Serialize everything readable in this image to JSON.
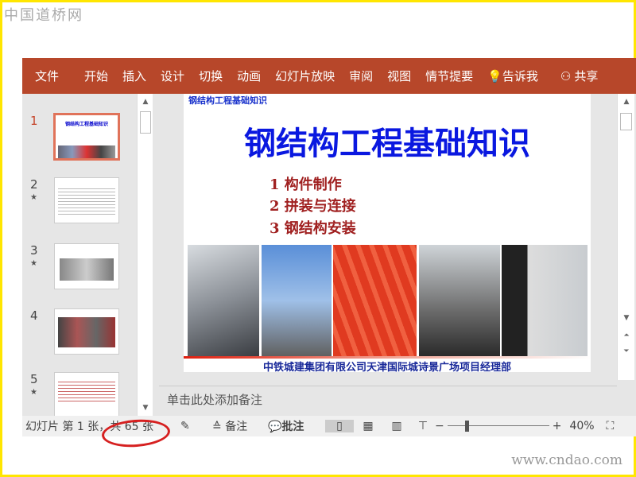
{
  "watermark_top": "中国道桥网",
  "watermark_bottom": "www.cndao.com",
  "ribbon": {
    "tabs": [
      "文件",
      "开始",
      "插入",
      "设计",
      "切换",
      "动画",
      "幻灯片放映",
      "审阅",
      "视图",
      "情节提要"
    ],
    "tell_me": "告诉我",
    "share": "共享"
  },
  "thumbnails": [
    {
      "num": "1",
      "star": ""
    },
    {
      "num": "2",
      "star": "★"
    },
    {
      "num": "3",
      "star": "★"
    },
    {
      "num": "4",
      "star": ""
    },
    {
      "num": "5",
      "star": "★"
    }
  ],
  "slide": {
    "small_title": "钢结构工程基础知识",
    "title": "钢结构工程基础知识",
    "items": [
      "1  构件制作",
      "2  拼装与连接",
      "3  钢结构安装"
    ],
    "footer": "中铁城建集团有限公司天津国际城诗景广场项目经理部"
  },
  "notes_placeholder": "单击此处添加备注",
  "status": {
    "slide_info": "幻灯片 第 1 张，共 65 张",
    "notes": "备注",
    "comments": "批注",
    "zoom": "40%"
  },
  "colors": {
    "ribbon": "#b7472a",
    "title": "#0a18e0",
    "annotation": "#d62020"
  }
}
